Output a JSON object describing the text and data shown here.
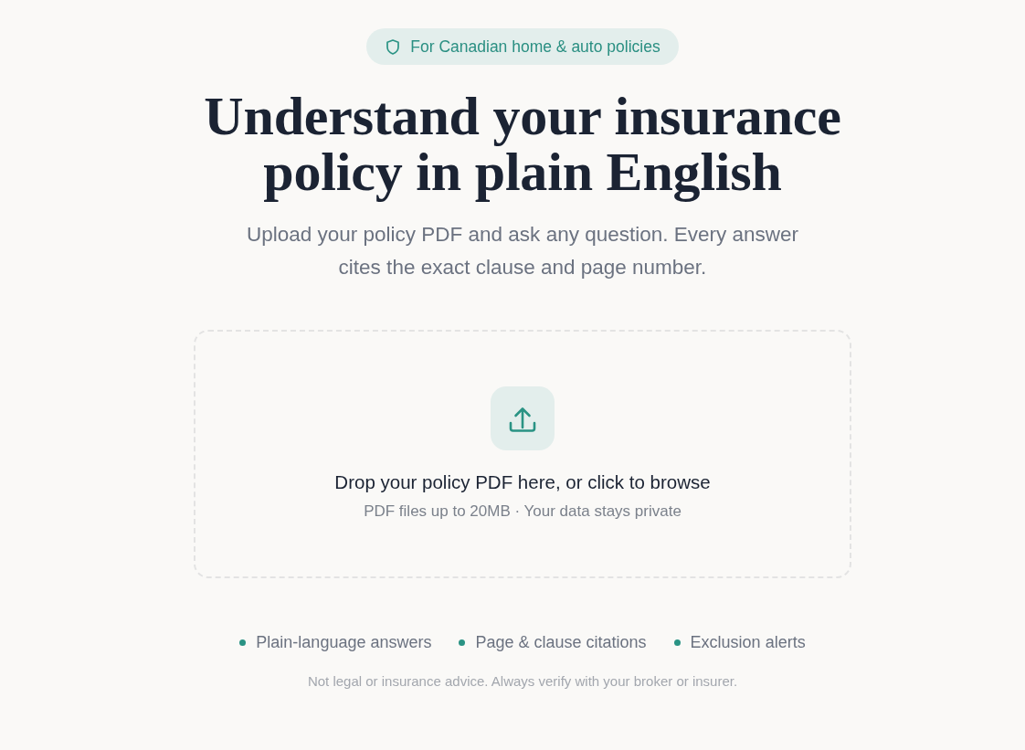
{
  "badge": {
    "text": "For Canadian home & auto policies"
  },
  "heading": "Understand your insurance policy in plain English",
  "subtitle": "Upload your policy PDF and ask any question. Every answer cites the exact clause and page number.",
  "dropzone": {
    "prompt": "Drop your policy PDF here, or click to browse",
    "note": "PDF files up to 20MB · Your data stays private"
  },
  "features": [
    {
      "text": "Plain-language answers"
    },
    {
      "text": "Page & clause citations"
    },
    {
      "text": "Exclusion alerts"
    }
  ],
  "disclaimer": "Not legal or insurance advice. Always verify with your broker or insurer."
}
